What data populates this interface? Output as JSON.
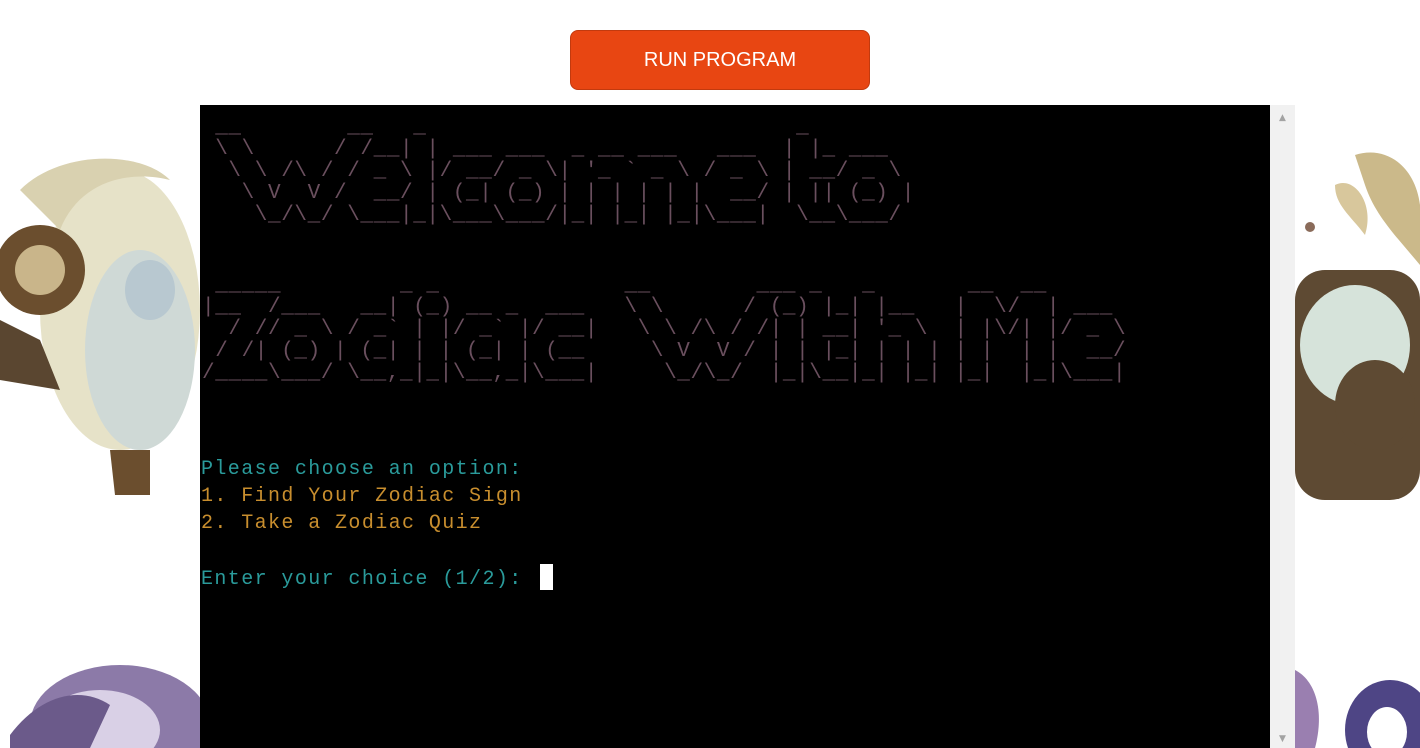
{
  "toolbar": {
    "run_label": "RUN PROGRAM"
  },
  "terminal": {
    "banner_line1": " __        __   _                            _\n \\ \\      / /__| | ___ ___  _ __ ___   ___  | |_ ___\n  \\ \\ /\\ / / _ \\ |/ __/ _ \\| '_ ` _ \\ / _ \\ | __/ _ \\\n   \\ V  V /  __/ | (_| (_) | | | | | |  __/ | || (_) |\n    \\_/\\_/ \\___|_|\\___\\___/|_| |_| |_|\\___|  \\__\\___/",
    "banner_line2": " _____         _ _              __        ___ _   _       __  __\n|__  /___   __| (_) __ _  ___   \\ \\      / (_) |_| |__   |  \\/  | ___\n  / // _ \\ / _` | |/ _` |/ __|   \\ \\ /\\ / /| | __| '_ \\  | |\\/| |/ _ \\\n / /| (_) | (_| | | (_| | (__     \\ V  V / | | |_| | | | | |  | |  __/\n/____\\___/ \\__,_|_|\\__,_|\\___|     \\_/\\_/  |_|\\__|_| |_| |_|  |_|\\___|",
    "prompt": "Please choose an option:",
    "option1": "1. Find Your Zodiac Sign",
    "option2": "2. Take a Zodiac Quiz",
    "input_prompt": "Enter your choice (1/2): "
  },
  "colors": {
    "run_button": "#e84612",
    "terminal_bg": "#000000",
    "prompt_text": "#2a9b9b",
    "option_text": "#c88e2e",
    "ascii_art": "#6a4f5e"
  },
  "icons": {
    "scroll_up": "scroll-up-arrow-icon",
    "scroll_down": "scroll-down-arrow-icon"
  }
}
